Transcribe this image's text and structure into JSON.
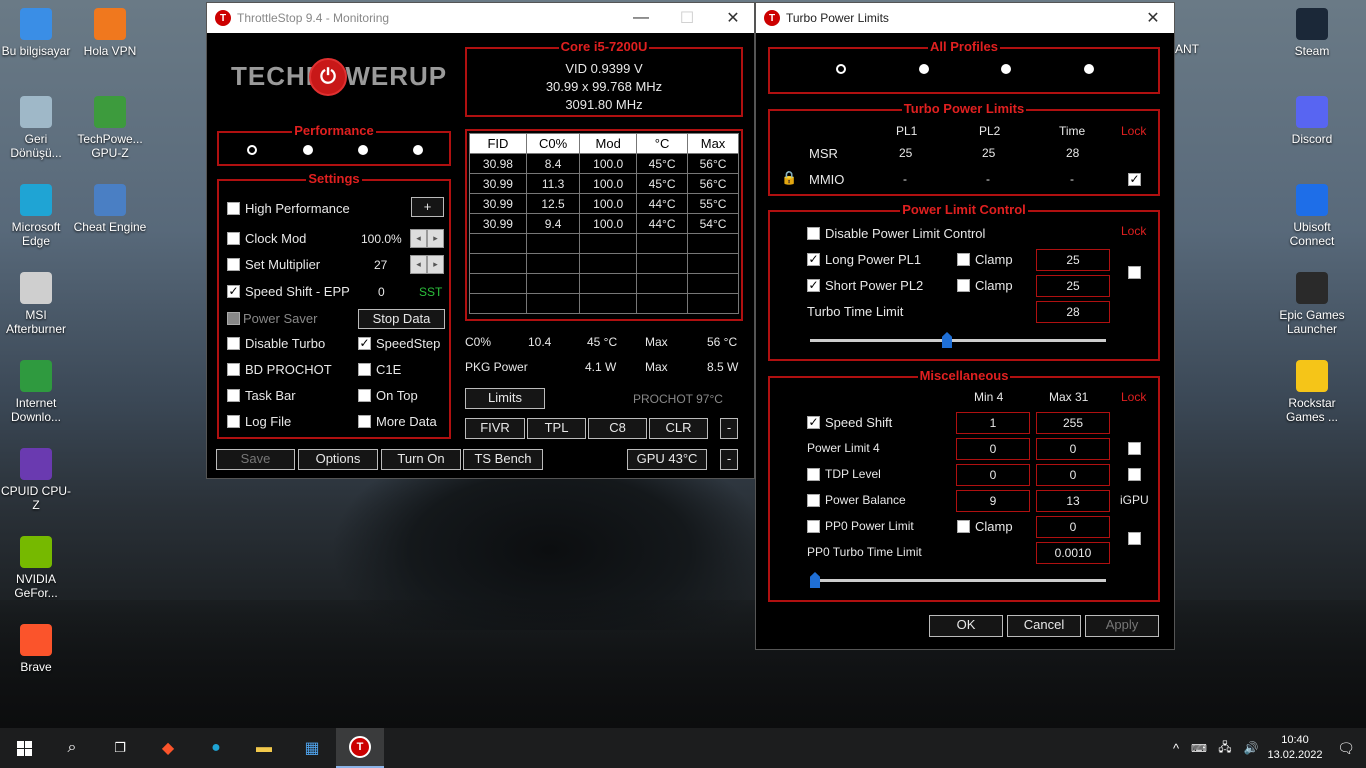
{
  "desktop": {
    "icons_left": [
      {
        "label": "Bu bilgisayar",
        "icon": "computer-icon",
        "color": "#3a8ee6"
      },
      {
        "label": "Hola VPN",
        "icon": "flame-icon",
        "color": "#f0781e"
      },
      {
        "label": "Geri Dönüşü...",
        "icon": "recycle-bin-icon",
        "color": "#9fb8c8"
      },
      {
        "label": "TechPowe... GPU-Z",
        "icon": "gpu-z-icon",
        "color": "#3d9b3d"
      },
      {
        "label": "Microsoft Edge",
        "icon": "edge-icon",
        "color": "#1fa4d4"
      },
      {
        "label": "Cheat Engine",
        "icon": "cheat-engine-icon",
        "color": "#4a7fc4"
      },
      {
        "label": "MSI Afterburner",
        "icon": "afterburner-icon",
        "color": "#cfcfcf"
      },
      {
        "label": "Internet Downlo...",
        "icon": "idm-icon",
        "color": "#2f9a3f"
      },
      {
        "label": "CPUID CPU-Z",
        "icon": "cpu-z-icon",
        "color": "#6a3ab0"
      },
      {
        "label": "NVIDIA GeFor...",
        "icon": "nvidia-icon",
        "color": "#76b900"
      },
      {
        "label": "Brave",
        "icon": "brave-icon",
        "color": "#fb542b"
      }
    ],
    "icons_right": [
      {
        "label": "Steam",
        "icon": "steam-icon",
        "color": "#1b2838"
      },
      {
        "label": "Discord",
        "icon": "discord-icon",
        "color": "#5865f2"
      },
      {
        "label": "Ubisoft Connect",
        "icon": "ubisoft-icon",
        "color": "#1e6ee8"
      },
      {
        "label": "Epic Games Launcher",
        "icon": "epic-icon",
        "color": "#2a2a2a"
      },
      {
        "label": "Rockstar Games ...",
        "icon": "rockstar-icon",
        "color": "#f5c518"
      }
    ],
    "partial_text": "ANT"
  },
  "throttlestop": {
    "title": "ThrottleStop 9.4 - Monitoring",
    "logo": "TECHPOWERUP",
    "core": {
      "title": "Core i5-7200U",
      "vid": "VID  0.9399 V",
      "mult": "30.99 x 99.768 MHz",
      "freq": "3091.80 MHz"
    },
    "performance": {
      "title": "Performance"
    },
    "settings": {
      "title": "Settings",
      "high_performance": "High Performance",
      "plus": "+",
      "clock_mod": "Clock Mod",
      "clock_mod_value": "100.0%",
      "set_multiplier": "Set Multiplier",
      "set_multiplier_value": "27",
      "speed_shift": "Speed Shift - EPP",
      "speed_shift_value": "0",
      "sst": "SST",
      "power_saver": "Power Saver",
      "stop_data": "Stop Data",
      "disable_turbo": "Disable Turbo",
      "speedstep": "SpeedStep",
      "bd_prochot": "BD PROCHOT",
      "c1e": "C1E",
      "task_bar": "Task Bar",
      "on_top": "On Top",
      "log_file": "Log File",
      "more_data": "More Data",
      "check_mark": "✓"
    },
    "table": {
      "headers": [
        "FID",
        "C0%",
        "Mod",
        "°C",
        "Max"
      ],
      "rows": [
        [
          "30.98",
          "8.4",
          "100.0",
          "45°C",
          "56°C"
        ],
        [
          "30.99",
          "11.3",
          "100.0",
          "45°C",
          "56°C"
        ],
        [
          "30.99",
          "12.5",
          "100.0",
          "44°C",
          "55°C"
        ],
        [
          "30.99",
          "9.4",
          "100.0",
          "44°C",
          "54°C"
        ]
      ]
    },
    "stats": {
      "c0_label": "C0%",
      "c0_value": "10.4",
      "temp": "45 °C",
      "max_label": "Max",
      "max_temp": "56 °C",
      "pkg_label": "PKG Power",
      "pkg_value": "4.1 W",
      "pkg_max_label": "Max",
      "pkg_max": "8.5 W",
      "prochot": "PROCHOT 97°C"
    },
    "buttons": {
      "limits": "Limits",
      "fivr": "FIVR",
      "tpl": "TPL",
      "c8": "C8",
      "clr": "CLR",
      "minus": "-",
      "save": "Save",
      "options": "Options",
      "turn_on": "Turn On",
      "ts_bench": "TS Bench",
      "gpu": "GPU 43°C"
    },
    "controls": {
      "minimize": "—",
      "maximize": "☐",
      "close": "✕"
    }
  },
  "tpl": {
    "title": "Turbo Power Limits",
    "close": "✕",
    "all_profiles": "All Profiles",
    "turbo_power_limits": {
      "title": "Turbo Power Limits",
      "pl1": "PL1",
      "pl2": "PL2",
      "time": "Time",
      "lock": "Lock",
      "msr": "MSR",
      "msr_pl1": "25",
      "msr_pl2": "25",
      "msr_time": "28",
      "mmio": "MMIO",
      "mmio_pl1": "-",
      "mmio_pl2": "-",
      "mmio_time": "-"
    },
    "power_limit_control": {
      "title": "Power Limit Control",
      "lock": "Lock",
      "disable": "Disable Power Limit Control",
      "long_pl1": "Long Power PL1",
      "long_pl1_value": "25",
      "short_pl2": "Short Power PL2",
      "short_pl2_value": "25",
      "clamp": "Clamp",
      "turbo_time": "Turbo Time Limit",
      "turbo_time_value": "28"
    },
    "misc": {
      "title": "Miscellaneous",
      "min": "Min  4",
      "max": "Max  31",
      "lock": "Lock",
      "speed_shift": "Speed Shift",
      "ss_min": "1",
      "ss_max": "255",
      "power_limit_4": "Power Limit 4",
      "pl4_a": "0",
      "pl4_b": "0",
      "tdp_level": "TDP Level",
      "tdp_a": "0",
      "tdp_b": "0",
      "power_balance": "Power Balance",
      "pb_a": "9",
      "pb_b": "13",
      "igpu": "iGPU",
      "pp0_limit": "PP0 Power Limit",
      "clamp": "Clamp",
      "pp0_value": "0",
      "pp0_time": "PP0 Turbo Time Limit",
      "pp0_time_value": "0.0010"
    },
    "ok": "OK",
    "cancel": "Cancel",
    "apply": "Apply"
  },
  "taskbar": {
    "time": "10:40",
    "date": "13.02.2022",
    "chevron": "^"
  }
}
